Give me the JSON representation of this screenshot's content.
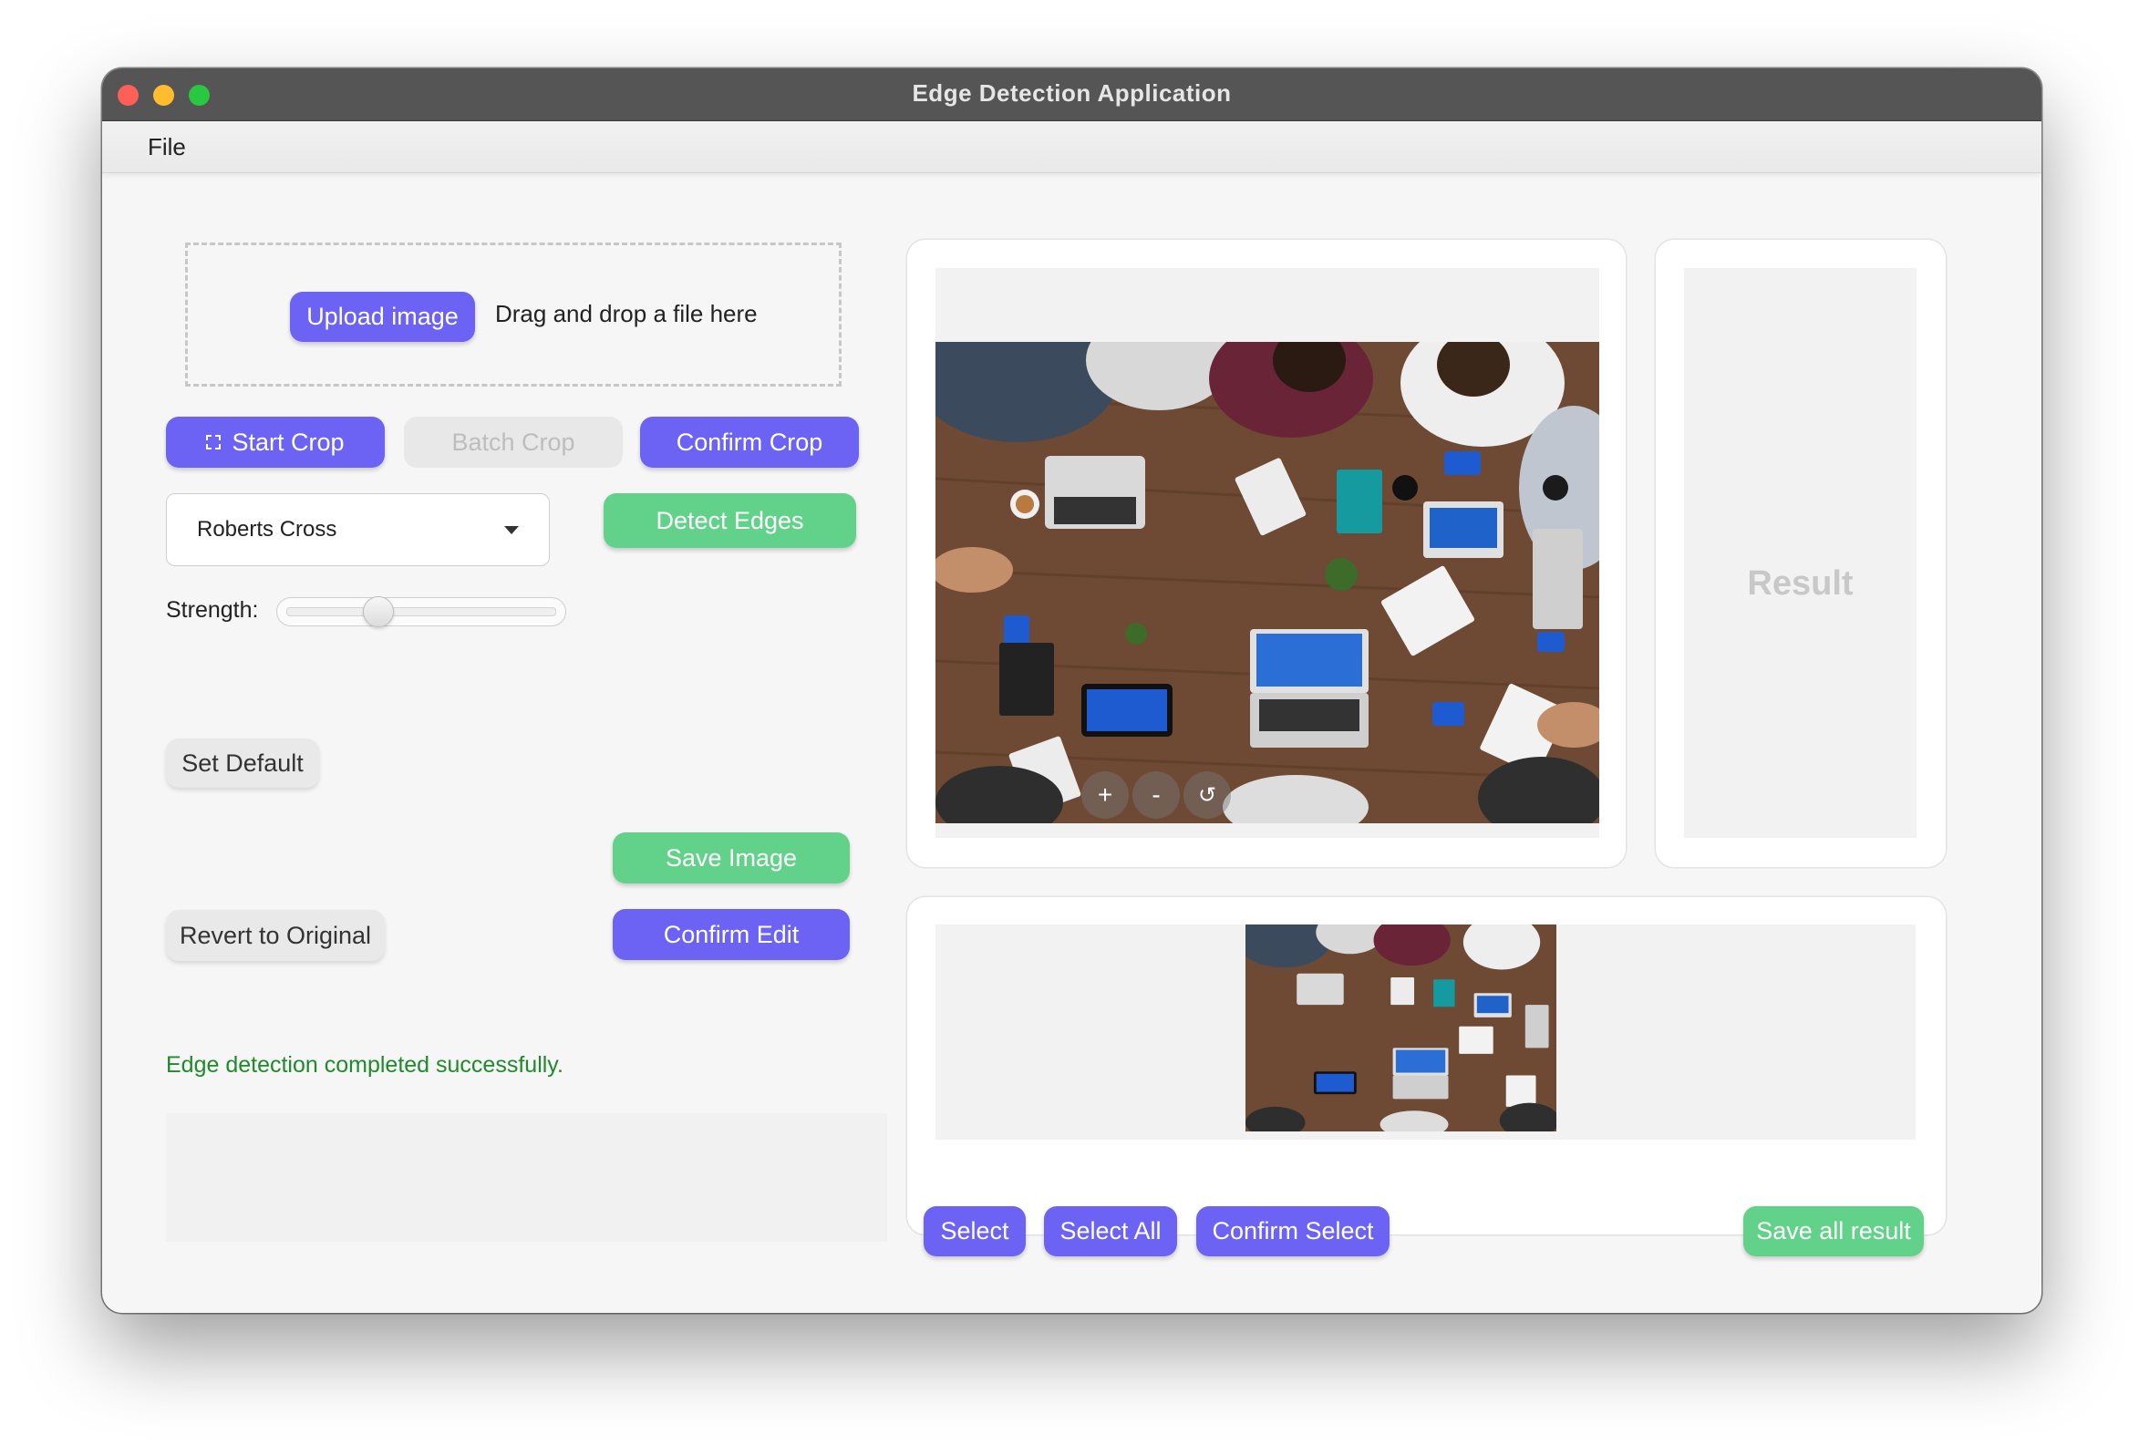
{
  "window": {
    "title": "Edge Detection Application"
  },
  "menu": {
    "file": "File"
  },
  "upload": {
    "button": "Upload image",
    "hint": "Drag and drop a file here"
  },
  "crop": {
    "start": "Start Crop",
    "batch": "Batch Crop",
    "confirm": "Confirm Crop"
  },
  "method": {
    "selected": "Roberts Cross"
  },
  "detect": {
    "button": "Detect Edges"
  },
  "strength": {
    "label": "Strength:",
    "value": 0.35
  },
  "actions": {
    "set_default": "Set Default",
    "save_image": "Save Image",
    "revert": "Revert to Original",
    "confirm_edit": "Confirm Edit"
  },
  "status": {
    "message": "Edge detection completed successfully."
  },
  "preview": {
    "zoom_in": "+",
    "zoom_out": "-",
    "reset": "↺"
  },
  "result": {
    "placeholder": "Result"
  },
  "selection": {
    "select": "Select",
    "select_all": "Select All",
    "confirm": "Confirm Select",
    "save_all": "Save all result"
  },
  "colors": {
    "accent_blue": "#6c63f5",
    "accent_green": "#62d18a",
    "status_green": "#1f8a2b"
  },
  "icons": {
    "crop": "crop-icon",
    "caret": "caret-down-icon"
  }
}
